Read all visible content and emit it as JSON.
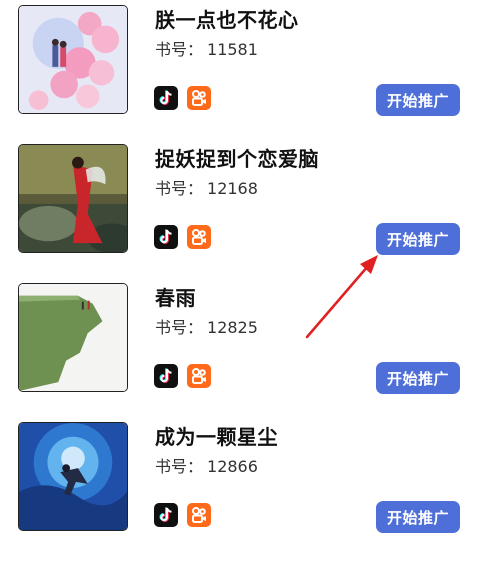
{
  "books": [
    {
      "title": "朕一点也不花心",
      "number_label": "书号：",
      "number": "11581",
      "cta": "开始推广"
    },
    {
      "title": "捉妖捉到个恋爱脑",
      "number_label": "书号：",
      "number": "12168",
      "cta": "开始推广"
    },
    {
      "title": "春雨",
      "number_label": "书号：",
      "number": "12825",
      "cta": "开始推广"
    },
    {
      "title": "成为一颗星尘",
      "number_label": "书号：",
      "number": "12866",
      "cta": "开始推广"
    }
  ],
  "platform_icons": [
    "tiktok-icon",
    "kuaishou-icon"
  ],
  "colors": {
    "button": "#4f6fd8",
    "tiktok_bg": "#101010",
    "kuaishou_bg": "#ff6a1a",
    "annotation_arrow": "#e02020"
  }
}
